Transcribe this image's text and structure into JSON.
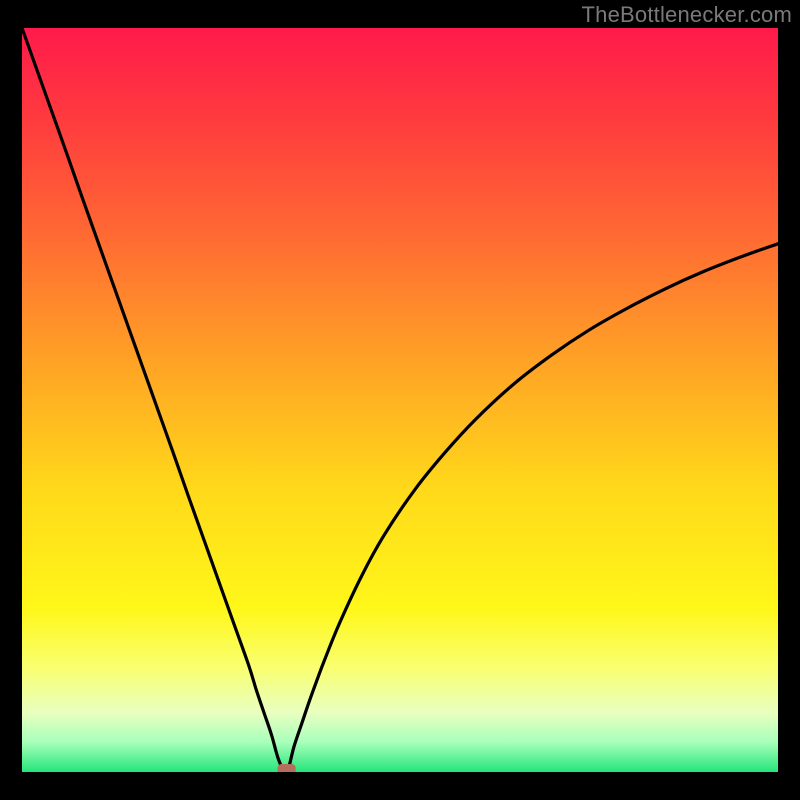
{
  "attribution": "TheBottlenecker.com",
  "chart_data": {
    "type": "line",
    "title": "",
    "xlabel": "",
    "ylabel": "",
    "xlim": [
      0,
      100
    ],
    "ylim": [
      0,
      100
    ],
    "minimum_x": 35,
    "marker": {
      "x": 35,
      "y": 0,
      "color": "#b56e5a"
    },
    "series": [
      {
        "name": "bottleneck-curve",
        "x": [
          0,
          2,
          4,
          6,
          8,
          10,
          12,
          14,
          16,
          18,
          20,
          22,
          24,
          26,
          28,
          30,
          31,
          32,
          33,
          34,
          35,
          36,
          37,
          38,
          39,
          40,
          42,
          45,
          48,
          52,
          56,
          60,
          65,
          70,
          75,
          80,
          85,
          90,
          95,
          100
        ],
        "y": [
          100,
          94.3,
          88.6,
          82.9,
          77.1,
          71.4,
          65.7,
          60.0,
          54.3,
          48.6,
          42.9,
          37.1,
          31.4,
          25.7,
          20.0,
          14.3,
          11.0,
          8.0,
          5.0,
          1.5,
          0.0,
          3.5,
          6.5,
          9.5,
          12.3,
          15.0,
          20.0,
          26.5,
          32.0,
          38.0,
          43.0,
          47.4,
          52.1,
          56.0,
          59.4,
          62.3,
          64.9,
          67.2,
          69.2,
          71.0
        ]
      }
    ],
    "gradient_stops": [
      {
        "offset": 0,
        "color": "#ff1a4b"
      },
      {
        "offset": 0.12,
        "color": "#ff3a3f"
      },
      {
        "offset": 0.28,
        "color": "#ff6a33"
      },
      {
        "offset": 0.45,
        "color": "#ffa325"
      },
      {
        "offset": 0.62,
        "color": "#ffd91a"
      },
      {
        "offset": 0.78,
        "color": "#fff71a"
      },
      {
        "offset": 0.86,
        "color": "#f9ff70"
      },
      {
        "offset": 0.92,
        "color": "#e8ffc0"
      },
      {
        "offset": 0.96,
        "color": "#a8ffba"
      },
      {
        "offset": 1.0,
        "color": "#25e57c"
      }
    ]
  }
}
